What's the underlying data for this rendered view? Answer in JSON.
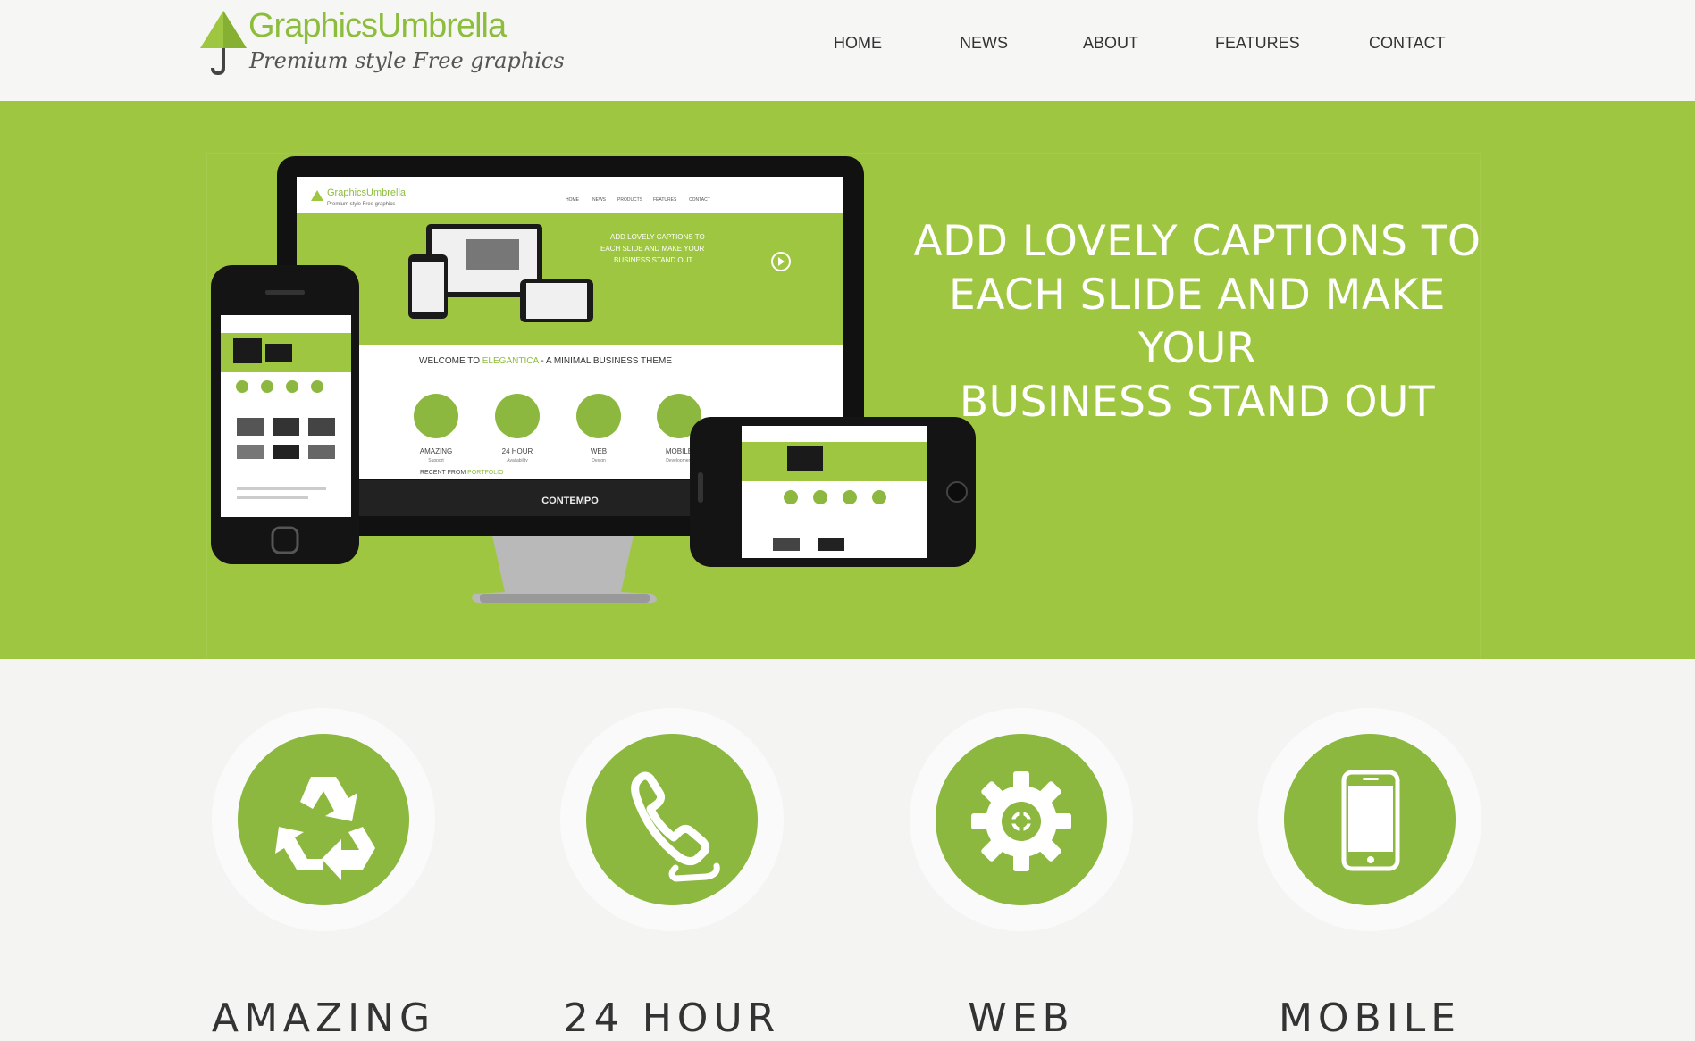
{
  "logo": {
    "title_part1": "Graphics",
    "title_part2": "Umbrella",
    "tagline": "Premium style Free graphics"
  },
  "nav": {
    "items": [
      "HOME",
      "NEWS",
      "ABOUT",
      "FEATURES",
      "CONTACT"
    ]
  },
  "hero": {
    "caption_lines": [
      "ADD LOVELY CAPTIONS TO",
      "EACH SLIDE AND MAKE YOUR",
      "BUSINESS STAND OUT"
    ],
    "mockup": {
      "monitor_brand": "CONTEMPO",
      "screen_logo": "GraphicsUmbrella",
      "screen_tagline": "Premium style Free graphics",
      "screen_nav": [
        "HOME",
        "NEWS",
        "PRODUCTS",
        "FEATURES",
        "CONTACT"
      ],
      "screen_caption": "ADD LOVELY CAPTIONS TO EACH SLIDE AND MAKE YOUR BUSINESS STAND OUT",
      "welcome_prefix": "WELCOME TO",
      "welcome_brand": "ELEGANTICA",
      "welcome_suffix": "- A MINIMAL BUSINESS THEME",
      "feature_titles": [
        "AMAZING",
        "24 HOUR",
        "WEB",
        "MOBILE"
      ],
      "feature_subs": [
        "Support",
        "Availability",
        "Design",
        "Development"
      ],
      "recent_prefix": "RECENT FROM",
      "recent_link": "PORTFOLIO"
    }
  },
  "features": [
    {
      "label": "AMAZING",
      "icon": "recycle-icon"
    },
    {
      "label": "24 HOUR",
      "icon": "phone-icon"
    },
    {
      "label": "WEB",
      "icon": "gear-icon"
    },
    {
      "label": "MOBILE",
      "icon": "mobile-icon"
    }
  ],
  "colors": {
    "brand_green": "#9fc641",
    "icon_green": "#8cb840",
    "logo_green": "#8dbd3c"
  }
}
